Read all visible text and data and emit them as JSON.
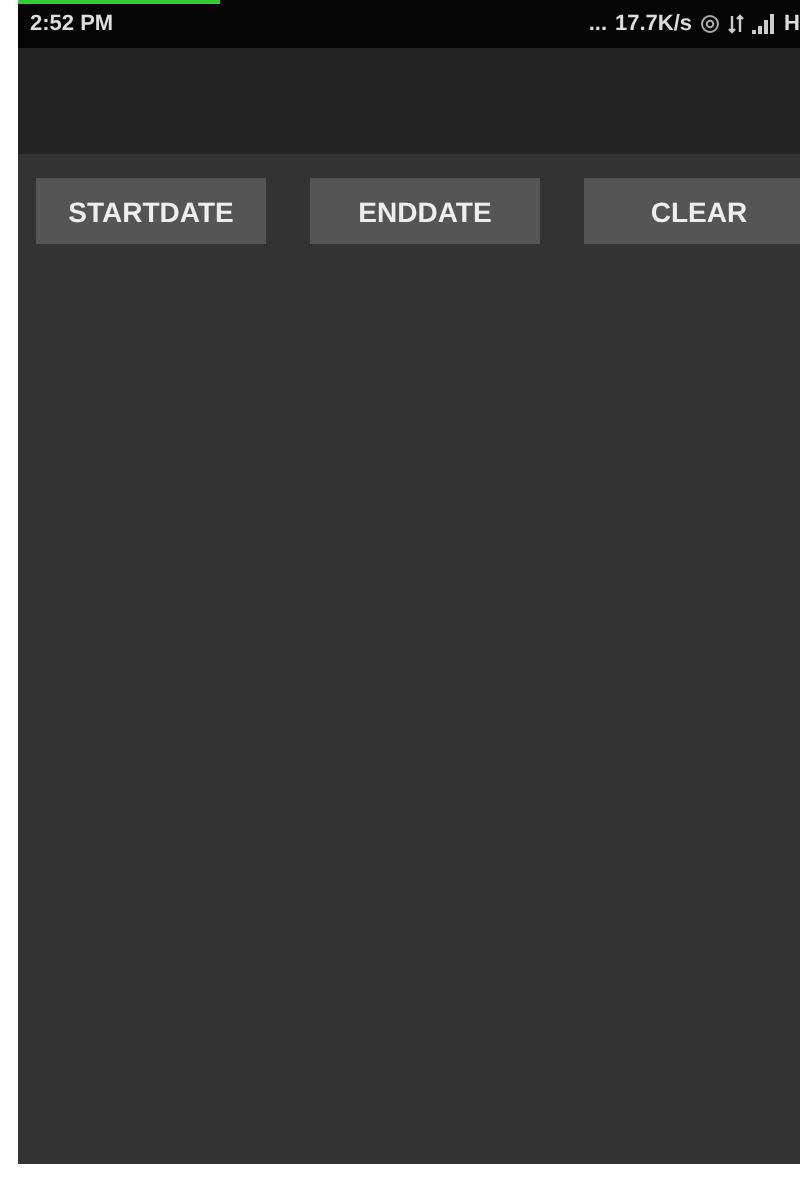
{
  "status_bar": {
    "time": "2:52 PM",
    "dots": "...",
    "speed": "17.7K/s",
    "network": "H"
  },
  "buttons": [
    {
      "label": "STARTDATE"
    },
    {
      "label": "ENDDATE"
    },
    {
      "label": "CLEAR"
    }
  ]
}
